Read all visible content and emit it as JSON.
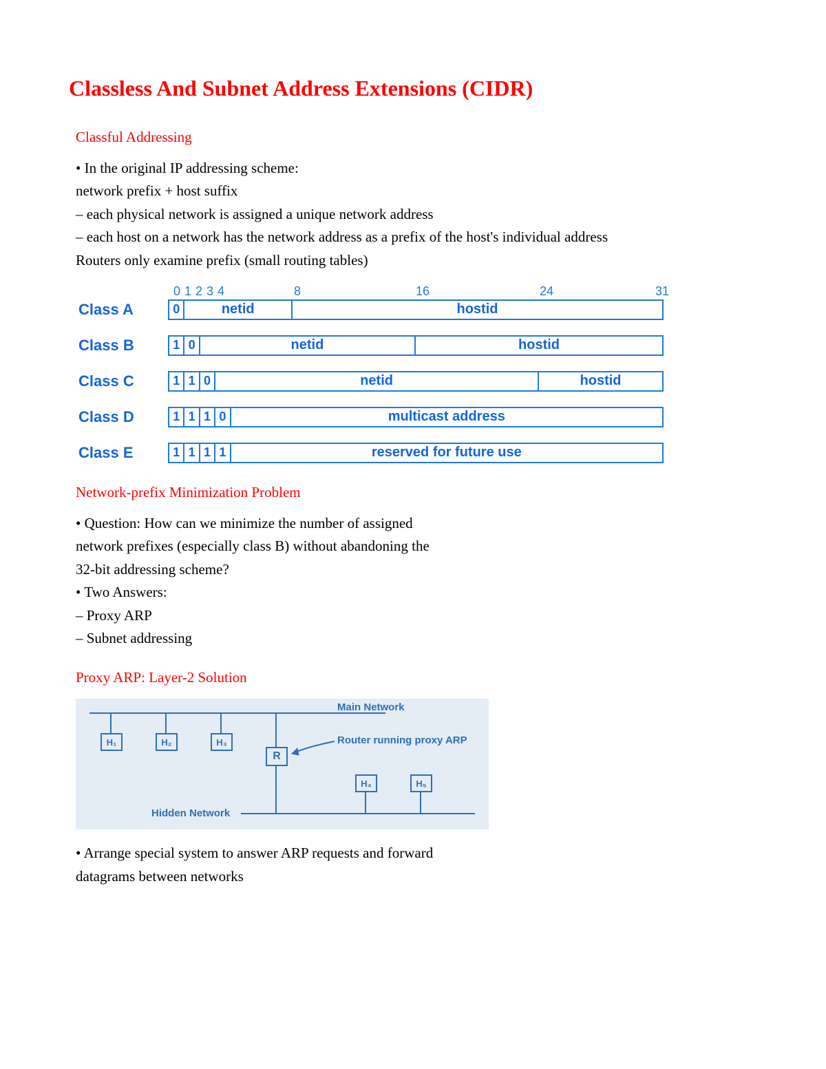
{
  "title": "Classless And Subnet Address Extensions (CIDR)",
  "sections": {
    "classful": {
      "heading": "Classful Addressing",
      "lines": [
        "• In the original IP addressing scheme:",
        "network prefix + host suffix",
        "– each physical network is assigned a unique network address",
        "– each host on a network has the network address as a prefix of the host's individual address",
        "Routers only examine prefix (small routing tables)"
      ]
    },
    "minimization": {
      "heading": "Network-prefix Minimization Problem",
      "lines": [
        "• Question: How can we minimize the number of assigned",
        "network prefixes (especially class B) without abandoning the",
        "32-bit addressing scheme?",
        "• Two Answers:",
        "– Proxy ARP",
        "– Subnet addressing"
      ]
    },
    "proxy": {
      "heading": "Proxy ARP: Layer-2 Solution",
      "lines": [
        "• Arrange special system to answer ARP requests and forward",
        "datagrams between networks"
      ]
    }
  },
  "class_table": {
    "bit_markers": [
      "0",
      "1",
      "2",
      "3",
      "4",
      "8",
      "16",
      "24",
      "31"
    ],
    "rows": [
      {
        "name": "Class A",
        "prefix_bits": [
          "0"
        ],
        "segments": [
          {
            "label": "netid",
            "end": 8
          },
          {
            "label": "hostid",
            "end": 32
          }
        ]
      },
      {
        "name": "Class B",
        "prefix_bits": [
          "1",
          "0"
        ],
        "segments": [
          {
            "label": "netid",
            "end": 16
          },
          {
            "label": "hostid",
            "end": 32
          }
        ]
      },
      {
        "name": "Class C",
        "prefix_bits": [
          "1",
          "1",
          "0"
        ],
        "segments": [
          {
            "label": "netid",
            "end": 24
          },
          {
            "label": "hostid",
            "end": 32
          }
        ]
      },
      {
        "name": "Class D",
        "prefix_bits": [
          "1",
          "1",
          "1",
          "0"
        ],
        "segments": [
          {
            "label": "multicast address",
            "end": 32
          }
        ]
      },
      {
        "name": "Class E",
        "prefix_bits": [
          "1",
          "1",
          "1",
          "1"
        ],
        "segments": [
          {
            "label": "reserved for future use",
            "end": 32
          }
        ]
      }
    ]
  },
  "proxy_diagram": {
    "main_label": "Main Network",
    "hidden_label": "Hidden Network",
    "router_label": "Router running proxy ARP",
    "router": "R",
    "top_hosts": [
      "H₁",
      "H₂",
      "H₃"
    ],
    "bottom_hosts": [
      "H₄",
      "H₅"
    ]
  }
}
